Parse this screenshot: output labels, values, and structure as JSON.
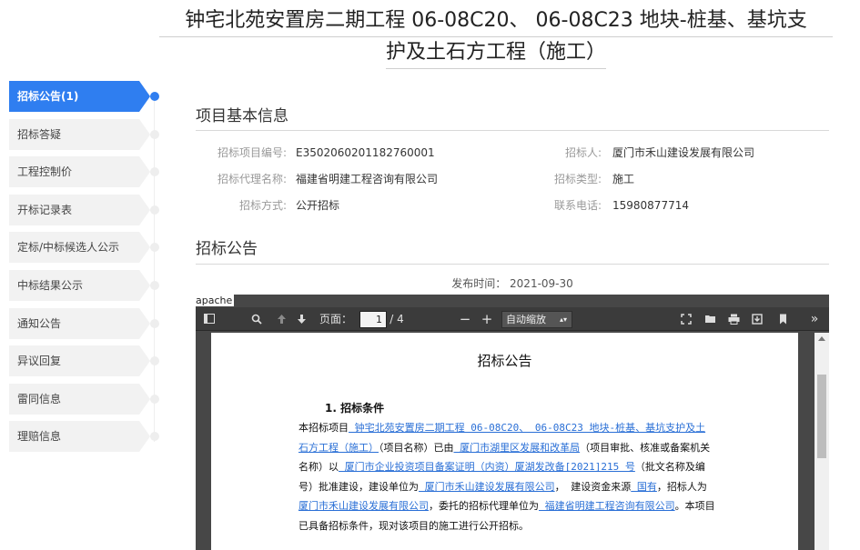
{
  "page": {
    "title_line1": "钟宅北苑安置房二期工程 06-08C20、 06-08C23 地块-桩基、基坑支",
    "title_line2": "护及土石方工程（施工）"
  },
  "sidebar": {
    "items": [
      {
        "label": "招标公告(1)",
        "active": true
      },
      {
        "label": "招标答疑"
      },
      {
        "label": "工程控制价"
      },
      {
        "label": "开标记录表"
      },
      {
        "label": "定标/中标候选人公示"
      },
      {
        "label": "中标结果公示"
      },
      {
        "label": "通知公告"
      },
      {
        "label": "异议回复"
      },
      {
        "label": "雷同信息"
      },
      {
        "label": "理赔信息"
      }
    ]
  },
  "basic_info": {
    "title": "项目基本信息",
    "project_no_label": "招标项目编号:",
    "project_no": "E3502060201182760001",
    "tenderer_label": "招标人:",
    "tenderer": "厦门市禾山建设发展有限公司",
    "agency_label": "招标代理名称:",
    "agency": "福建省明建工程咨询有限公司",
    "type_label": "招标类型:",
    "type": "施工",
    "method_label": "招标方式:",
    "method": "公开招标",
    "phone_label": "联系电话:",
    "phone": "15980877714"
  },
  "announcement": {
    "title": "招标公告",
    "publish_time": "发布时间： 2021-09-30"
  },
  "viewer": {
    "frame_label": "apache",
    "page_label": "页面：",
    "page_current": "1",
    "page_total": "/ 4",
    "zoom_label": "自动缩放",
    "icons": [
      "sidebar-toggle-icon",
      "search-icon",
      "arrow-up-icon",
      "arrow-down-icon",
      "minus-icon",
      "plus-icon",
      "fullscreen-icon",
      "open-file-icon",
      "print-icon",
      "download-icon",
      "bookmark-icon",
      "more-icon"
    ]
  },
  "document": {
    "title": "招标公告",
    "heading": "1. 招标条件",
    "p_a": "本招标项目",
    "p_b": " 钟宅北苑安置房二期工程 06-08C20、 06-08C23 地块-桩基、基坑支护及土石方工程（施工）",
    "p_c": "（项目名称）已由",
    "p_d": " 厦门市湖里区发展和改革局",
    "p_e": "（项目审批、核准或备案机关名称）以",
    "p_f": " 厦门市企业投资项目备案证明（内资）厦湖发改备[2021]215 号",
    "p_g": "（批文名称及编号）批准建设，建设单位为",
    "p_h": " 厦门市禾山建设发展有限公司",
    "p_i": "， 建设资金来源",
    "p_j": " 国有",
    "p_k": "，招标人为",
    "p_l": " 厦门市禾山建设发展有限公司",
    "p_m": "，委托的招标代理单位为",
    "p_n": " 福建省明建工程咨询有限公司",
    "p_o": "。本项目已具备招标条件，现对该项目的施工进行公开招标。"
  }
}
